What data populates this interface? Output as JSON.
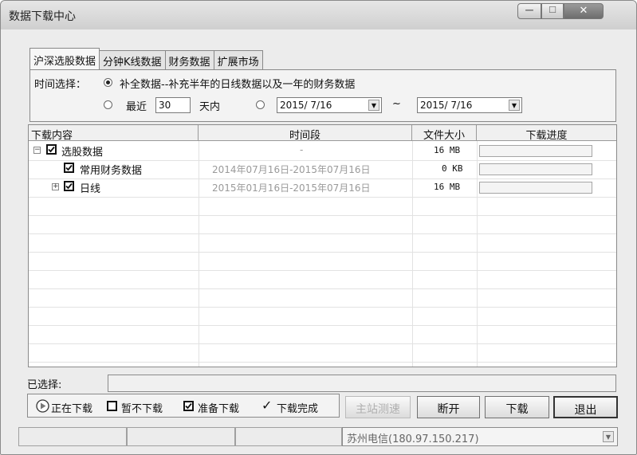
{
  "window": {
    "title": "数据下载中心"
  },
  "tabs": [
    "沪深选股数据",
    "分钟K线数据",
    "财务数据",
    "扩展市场"
  ],
  "time_select": {
    "label": "时间选择：",
    "option_full": "补全数据--补充半年的日线数据以及一年的财务数据",
    "option_recent_label": "最近",
    "recent_days": "30",
    "days_unit": "天内",
    "date_from": "2015/ 7/16",
    "date_sep": "~",
    "date_to": "2015/ 7/16"
  },
  "table": {
    "headers": [
      "下载内容",
      "时间段",
      "文件大小",
      "下载进度"
    ],
    "rows": [
      {
        "name": "选股数据",
        "period": "-",
        "size": "16 MB",
        "checked": true,
        "expander": "minus",
        "progress": 0
      },
      {
        "name": "常用财务数据",
        "period": "2014年07月16日-2015年07月16日",
        "size": "0 KB",
        "checked": true,
        "expander": "none",
        "progress": 0
      },
      {
        "name": "日线",
        "period": "2015年01月16日-2015年07月16日",
        "size": "16 MB",
        "checked": true,
        "expander": "plus",
        "progress": 0
      }
    ]
  },
  "selected_label": "已选择:",
  "legend": {
    "downloading": "正在下载",
    "paused": "暂不下载",
    "ready": "准备下载",
    "done": "下载完成"
  },
  "buttons": {
    "speedtest": "主站测速",
    "disconnect": "断开",
    "download": "下载",
    "exit": "退出"
  },
  "server": {
    "name": "苏州电信(180.97.150.217)"
  }
}
